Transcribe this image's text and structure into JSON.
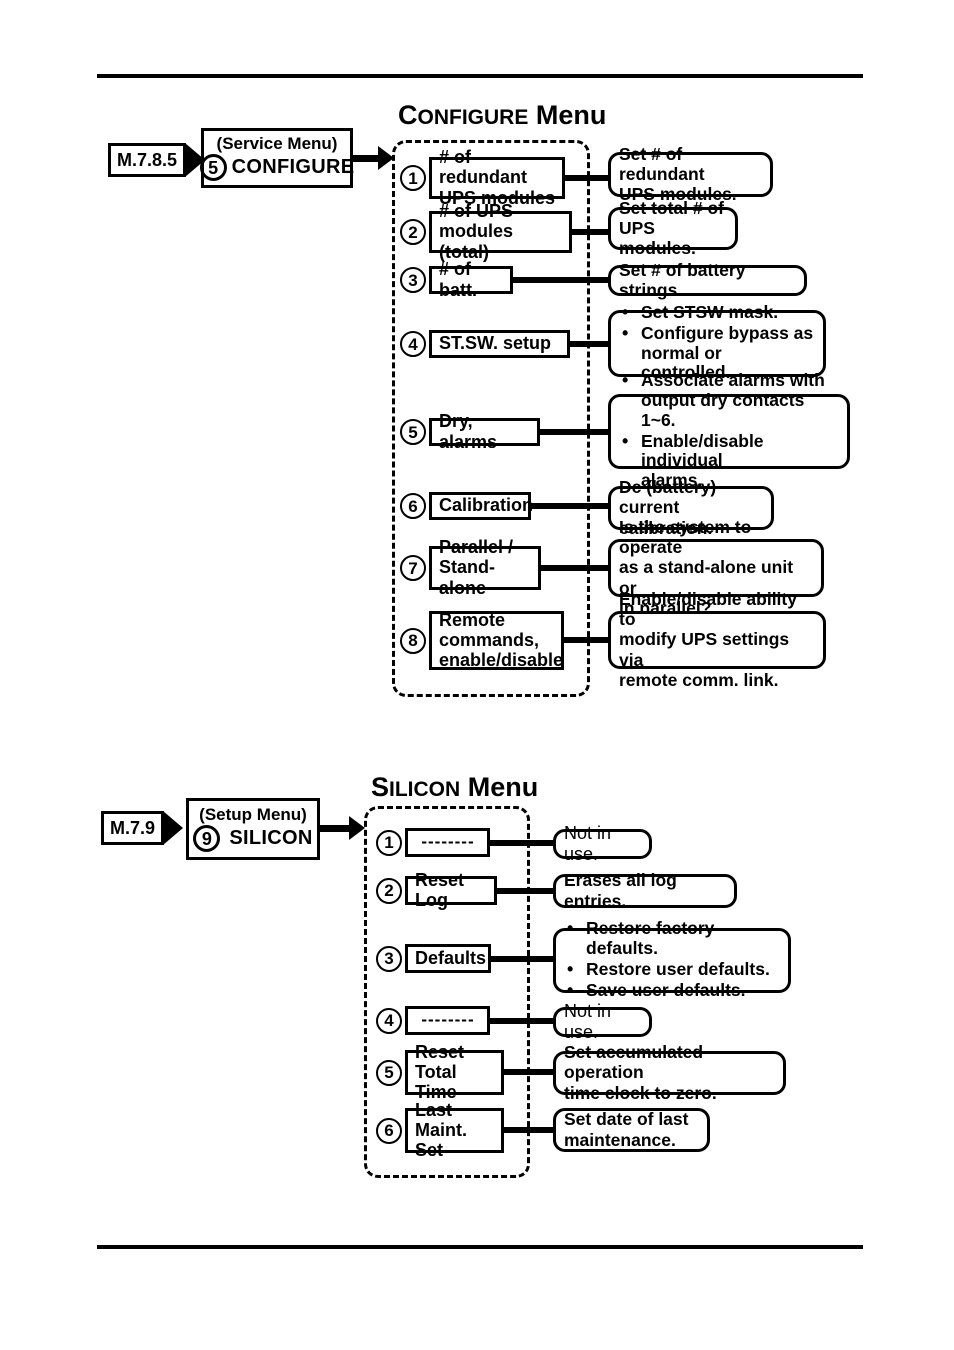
{
  "sections": [
    {
      "id": "configure",
      "title": {
        "lead": "C",
        "small": "ONFIGURE",
        "word": "Menu"
      },
      "ref_tag": "M.7.8.5",
      "origin": {
        "sub": "(Service Menu)",
        "number": "5",
        "label": "CONFIGURE"
      },
      "items": [
        {
          "number": "1",
          "label": "# of redundant\nUPS modules",
          "desc": "Set # of redundant\nUPS modules."
        },
        {
          "number": "2",
          "label": "# of UPS\nmodules (total)",
          "desc": "Set total # of\nUPS modules."
        },
        {
          "number": "3",
          "label": "# of batt.",
          "desc": "Set # of battery strings."
        },
        {
          "number": "4",
          "label": "ST.SW. setup",
          "desc_bullets": [
            "Set STSW mask.",
            "Configure bypass as\nnormal or controlled."
          ]
        },
        {
          "number": "5",
          "label": "Dry, alarms",
          "desc_bullets": [
            "Associate alarms with\noutput dry contacts 1~6.",
            "Enable/disable individual\nalarms."
          ]
        },
        {
          "number": "6",
          "label": "Calibration",
          "desc": "Dc (battery)\ncurrent calibration."
        },
        {
          "number": "7",
          "label": "Parallel /\nStand-alone",
          "desc": "Is the system to operate\nas a stand-alone unit or\nin parallel?"
        },
        {
          "number": "8",
          "label": "Remote\ncommands,\nenable/disable",
          "desc": "Enable/disable ability to\nmodify UPS settings via\nremote comm. link."
        }
      ]
    },
    {
      "id": "silicon",
      "title": {
        "lead": "S",
        "small": "ILICON",
        "word": "Menu"
      },
      "ref_tag": "M.7.9",
      "origin": {
        "sub": "(Setup Menu)",
        "number": "9",
        "label": "SILICON"
      },
      "items": [
        {
          "number": "1",
          "label": "--------",
          "desc": "Not in use.",
          "desc_plain": true
        },
        {
          "number": "2",
          "label": "Reset Log",
          "desc": "Erases all log entries."
        },
        {
          "number": "3",
          "label": "Defaults",
          "desc_bullets": [
            "Restore factory defaults.",
            "Restore user defaults.",
            "Save user defaults."
          ]
        },
        {
          "number": "4",
          "label": "--------",
          "desc": "Not in use.",
          "desc_plain": true
        },
        {
          "number": "5",
          "label": "Reset\nTotal Time",
          "desc": "Set accumulated operation\ntime clock to zero."
        },
        {
          "number": "6",
          "label": "Last Maint.\nSet",
          "desc": "Set date of last\nmaintenance."
        }
      ]
    }
  ]
}
